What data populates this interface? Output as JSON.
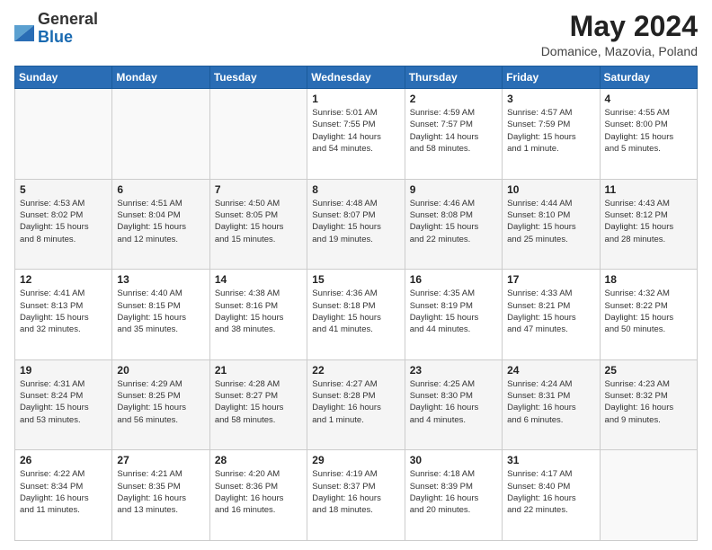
{
  "header": {
    "logo": {
      "general": "General",
      "blue": "Blue"
    },
    "title": "May 2024",
    "location": "Domanice, Mazovia, Poland"
  },
  "days_of_week": [
    "Sunday",
    "Monday",
    "Tuesday",
    "Wednesday",
    "Thursday",
    "Friday",
    "Saturday"
  ],
  "weeks": [
    [
      {
        "day": "",
        "info": ""
      },
      {
        "day": "",
        "info": ""
      },
      {
        "day": "",
        "info": ""
      },
      {
        "day": "1",
        "info": "Sunrise: 5:01 AM\nSunset: 7:55 PM\nDaylight: 14 hours\nand 54 minutes."
      },
      {
        "day": "2",
        "info": "Sunrise: 4:59 AM\nSunset: 7:57 PM\nDaylight: 14 hours\nand 58 minutes."
      },
      {
        "day": "3",
        "info": "Sunrise: 4:57 AM\nSunset: 7:59 PM\nDaylight: 15 hours\nand 1 minute."
      },
      {
        "day": "4",
        "info": "Sunrise: 4:55 AM\nSunset: 8:00 PM\nDaylight: 15 hours\nand 5 minutes."
      }
    ],
    [
      {
        "day": "5",
        "info": "Sunrise: 4:53 AM\nSunset: 8:02 PM\nDaylight: 15 hours\nand 8 minutes."
      },
      {
        "day": "6",
        "info": "Sunrise: 4:51 AM\nSunset: 8:04 PM\nDaylight: 15 hours\nand 12 minutes."
      },
      {
        "day": "7",
        "info": "Sunrise: 4:50 AM\nSunset: 8:05 PM\nDaylight: 15 hours\nand 15 minutes."
      },
      {
        "day": "8",
        "info": "Sunrise: 4:48 AM\nSunset: 8:07 PM\nDaylight: 15 hours\nand 19 minutes."
      },
      {
        "day": "9",
        "info": "Sunrise: 4:46 AM\nSunset: 8:08 PM\nDaylight: 15 hours\nand 22 minutes."
      },
      {
        "day": "10",
        "info": "Sunrise: 4:44 AM\nSunset: 8:10 PM\nDaylight: 15 hours\nand 25 minutes."
      },
      {
        "day": "11",
        "info": "Sunrise: 4:43 AM\nSunset: 8:12 PM\nDaylight: 15 hours\nand 28 minutes."
      }
    ],
    [
      {
        "day": "12",
        "info": "Sunrise: 4:41 AM\nSunset: 8:13 PM\nDaylight: 15 hours\nand 32 minutes."
      },
      {
        "day": "13",
        "info": "Sunrise: 4:40 AM\nSunset: 8:15 PM\nDaylight: 15 hours\nand 35 minutes."
      },
      {
        "day": "14",
        "info": "Sunrise: 4:38 AM\nSunset: 8:16 PM\nDaylight: 15 hours\nand 38 minutes."
      },
      {
        "day": "15",
        "info": "Sunrise: 4:36 AM\nSunset: 8:18 PM\nDaylight: 15 hours\nand 41 minutes."
      },
      {
        "day": "16",
        "info": "Sunrise: 4:35 AM\nSunset: 8:19 PM\nDaylight: 15 hours\nand 44 minutes."
      },
      {
        "day": "17",
        "info": "Sunrise: 4:33 AM\nSunset: 8:21 PM\nDaylight: 15 hours\nand 47 minutes."
      },
      {
        "day": "18",
        "info": "Sunrise: 4:32 AM\nSunset: 8:22 PM\nDaylight: 15 hours\nand 50 minutes."
      }
    ],
    [
      {
        "day": "19",
        "info": "Sunrise: 4:31 AM\nSunset: 8:24 PM\nDaylight: 15 hours\nand 53 minutes."
      },
      {
        "day": "20",
        "info": "Sunrise: 4:29 AM\nSunset: 8:25 PM\nDaylight: 15 hours\nand 56 minutes."
      },
      {
        "day": "21",
        "info": "Sunrise: 4:28 AM\nSunset: 8:27 PM\nDaylight: 15 hours\nand 58 minutes."
      },
      {
        "day": "22",
        "info": "Sunrise: 4:27 AM\nSunset: 8:28 PM\nDaylight: 16 hours\nand 1 minute."
      },
      {
        "day": "23",
        "info": "Sunrise: 4:25 AM\nSunset: 8:30 PM\nDaylight: 16 hours\nand 4 minutes."
      },
      {
        "day": "24",
        "info": "Sunrise: 4:24 AM\nSunset: 8:31 PM\nDaylight: 16 hours\nand 6 minutes."
      },
      {
        "day": "25",
        "info": "Sunrise: 4:23 AM\nSunset: 8:32 PM\nDaylight: 16 hours\nand 9 minutes."
      }
    ],
    [
      {
        "day": "26",
        "info": "Sunrise: 4:22 AM\nSunset: 8:34 PM\nDaylight: 16 hours\nand 11 minutes."
      },
      {
        "day": "27",
        "info": "Sunrise: 4:21 AM\nSunset: 8:35 PM\nDaylight: 16 hours\nand 13 minutes."
      },
      {
        "day": "28",
        "info": "Sunrise: 4:20 AM\nSunset: 8:36 PM\nDaylight: 16 hours\nand 16 minutes."
      },
      {
        "day": "29",
        "info": "Sunrise: 4:19 AM\nSunset: 8:37 PM\nDaylight: 16 hours\nand 18 minutes."
      },
      {
        "day": "30",
        "info": "Sunrise: 4:18 AM\nSunset: 8:39 PM\nDaylight: 16 hours\nand 20 minutes."
      },
      {
        "day": "31",
        "info": "Sunrise: 4:17 AM\nSunset: 8:40 PM\nDaylight: 16 hours\nand 22 minutes."
      },
      {
        "day": "",
        "info": ""
      }
    ]
  ]
}
